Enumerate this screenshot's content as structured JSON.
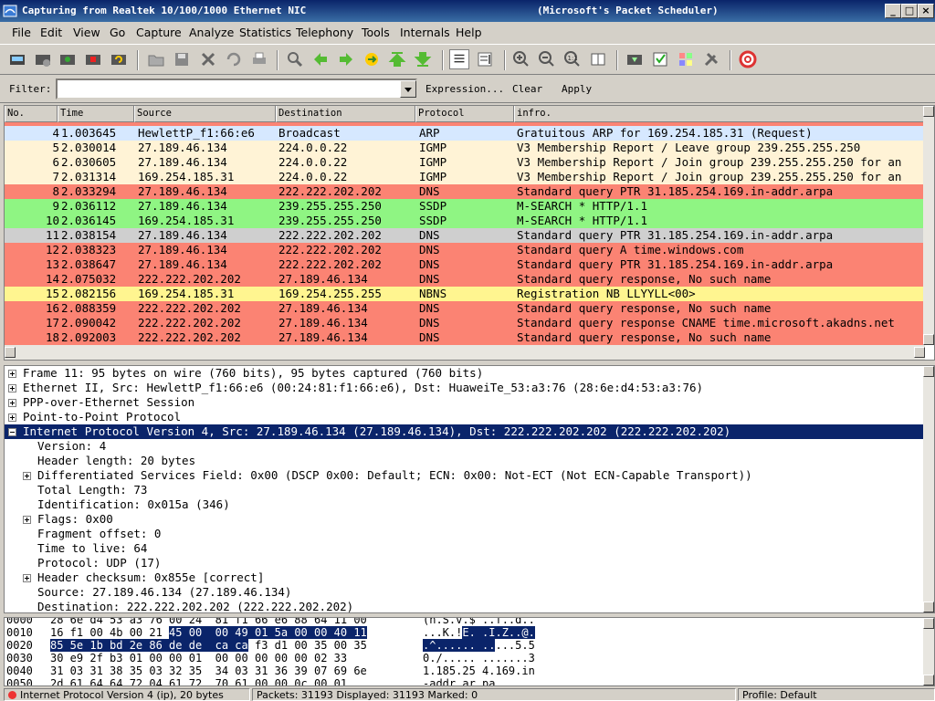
{
  "window": {
    "title": "Capturing from Realtek 10/100/1000 Ethernet NIC",
    "subtitle": "(Microsoft's Packet Scheduler)"
  },
  "menu": [
    "File",
    "Edit",
    "View",
    "Go",
    "Capture",
    "Analyze",
    "Statistics",
    "Telephony",
    "Tools",
    "Internals",
    "Help"
  ],
  "filter": {
    "label": "Filter:",
    "value": "",
    "expression": "Expression...",
    "clear": "Clear",
    "apply": "Apply"
  },
  "columns": [
    "No.",
    "Time",
    "Source",
    "Destination",
    "Protocol",
    "infro."
  ],
  "packets": [
    {
      "no": "4",
      "time": "1.003645",
      "src": "HewlettP_f1:66:e6",
      "dst": "Broadcast",
      "proto": "ARP",
      "info": "Gratuitous ARP for 169.254.185.31 (Request)",
      "color": "#d6e8ff"
    },
    {
      "no": "5",
      "time": "2.030014",
      "src": "27.189.46.134",
      "dst": "224.0.0.22",
      "proto": "IGMP",
      "info": "V3 Membership Report / Leave group 239.255.255.250",
      "color": "#fff3d6"
    },
    {
      "no": "6",
      "time": "2.030605",
      "src": "27.189.46.134",
      "dst": "224.0.0.22",
      "proto": "IGMP",
      "info": "V3 Membership Report / Join group 239.255.255.250 for an",
      "color": "#fff3d6"
    },
    {
      "no": "7",
      "time": "2.031314",
      "src": "169.254.185.31",
      "dst": "224.0.0.22",
      "proto": "IGMP",
      "info": "V3 Membership Report / Join group 239.255.255.250 for an",
      "color": "#fff3d6"
    },
    {
      "no": "8",
      "time": "2.033294",
      "src": "27.189.46.134",
      "dst": "222.222.202.202",
      "proto": "DNS",
      "info": "Standard query PTR 31.185.254.169.in-addr.arpa",
      "color": "#fb8373"
    },
    {
      "no": "9",
      "time": "2.036112",
      "src": "27.189.46.134",
      "dst": "239.255.255.250",
      "proto": "SSDP",
      "info": "M-SEARCH * HTTP/1.1",
      "color": "#8ff583"
    },
    {
      "no": "10",
      "time": "2.036145",
      "src": "169.254.185.31",
      "dst": "239.255.255.250",
      "proto": "SSDP",
      "info": "M-SEARCH * HTTP/1.1",
      "color": "#8ff583"
    },
    {
      "no": "11",
      "time": "2.038154",
      "src": "27.189.46.134",
      "dst": "222.222.202.202",
      "proto": "DNS",
      "info": "Standard query PTR 31.185.254.169.in-addr.arpa",
      "color": "#cfcfcf"
    },
    {
      "no": "12",
      "time": "2.038323",
      "src": "27.189.46.134",
      "dst": "222.222.202.202",
      "proto": "DNS",
      "info": "Standard query A time.windows.com",
      "color": "#fb8373"
    },
    {
      "no": "13",
      "time": "2.038647",
      "src": "27.189.46.134",
      "dst": "222.222.202.202",
      "proto": "DNS",
      "info": "Standard query PTR 31.185.254.169.in-addr.arpa",
      "color": "#fb8373"
    },
    {
      "no": "14",
      "time": "2.075032",
      "src": "222.222.202.202",
      "dst": "27.189.46.134",
      "proto": "DNS",
      "info": "Standard query response, No such name",
      "color": "#fb8373"
    },
    {
      "no": "15",
      "time": "2.082156",
      "src": "169.254.185.31",
      "dst": "169.254.255.255",
      "proto": "NBNS",
      "info": "Registration NB LLYYLL<00>",
      "color": "#fff590"
    },
    {
      "no": "16",
      "time": "2.088359",
      "src": "222.222.202.202",
      "dst": "27.189.46.134",
      "proto": "DNS",
      "info": "Standard query response, No such name",
      "color": "#fb8373"
    },
    {
      "no": "17",
      "time": "2.090042",
      "src": "222.222.202.202",
      "dst": "27.189.46.134",
      "proto": "DNS",
      "info": "Standard query response CNAME time.microsoft.akadns.net",
      "color": "#fb8373"
    },
    {
      "no": "18",
      "time": "2.092003",
      "src": "222.222.202.202",
      "dst": "27.189.46.134",
      "proto": "DNS",
      "info": "Standard query response, No such name",
      "color": "#fb8373"
    }
  ],
  "tree": [
    {
      "text": "Frame 11: 95 bytes on wire (760 bits), 95 bytes captured (760 bits)",
      "level": 0,
      "expander": "closed",
      "selected": false
    },
    {
      "text": "Ethernet II, Src: HewlettP_f1:66:e6 (00:24:81:f1:66:e6), Dst: HuaweiTe_53:a3:76 (28:6e:d4:53:a3:76)",
      "level": 0,
      "expander": "closed",
      "selected": false
    },
    {
      "text": "PPP-over-Ethernet Session",
      "level": 0,
      "expander": "closed",
      "selected": false
    },
    {
      "text": "Point-to-Point Protocol",
      "level": 0,
      "expander": "closed",
      "selected": false
    },
    {
      "text": "Internet Protocol Version 4, Src: 27.189.46.134 (27.189.46.134), Dst: 222.222.202.202 (222.222.202.202)",
      "level": 0,
      "expander": "open",
      "selected": true
    },
    {
      "text": "Version: 4",
      "level": 1,
      "expander": "none",
      "selected": false
    },
    {
      "text": "Header length: 20 bytes",
      "level": 1,
      "expander": "none",
      "selected": false
    },
    {
      "text": "Differentiated Services Field: 0x00 (DSCP 0x00: Default; ECN: 0x00: Not-ECT (Not ECN-Capable Transport))",
      "level": 1,
      "expander": "closed",
      "selected": false
    },
    {
      "text": "Total Length: 73",
      "level": 1,
      "expander": "none",
      "selected": false
    },
    {
      "text": "Identification: 0x015a (346)",
      "level": 1,
      "expander": "none",
      "selected": false
    },
    {
      "text": "Flags: 0x00",
      "level": 1,
      "expander": "closed",
      "selected": false
    },
    {
      "text": "Fragment offset: 0",
      "level": 1,
      "expander": "none",
      "selected": false
    },
    {
      "text": "Time to live: 64",
      "level": 1,
      "expander": "none",
      "selected": false
    },
    {
      "text": "Protocol: UDP (17)",
      "level": 1,
      "expander": "none",
      "selected": false
    },
    {
      "text": "Header checksum: 0x855e [correct]",
      "level": 1,
      "expander": "closed",
      "selected": false
    },
    {
      "text": "Source: 27.189.46.134 (27.189.46.134)",
      "level": 1,
      "expander": "none",
      "selected": false
    },
    {
      "text": "Destination: 222.222.202.202 (222.222.202.202)",
      "level": 1,
      "expander": "none",
      "selected": false
    }
  ],
  "bytes": [
    {
      "offset": "0000",
      "pre": "28 6e d4 53 a3 76 00 24  81 f1 66 e6 88 64 11 00",
      "hl": "",
      "post": "",
      "apre": "(n.S.v.$ ..f..d..",
      "ahl": "",
      "apost": ""
    },
    {
      "offset": "0010",
      "pre": "16 f1 00 4b 00 21 ",
      "hl": "45 00  00 49 01 5a 00 00 40 11",
      "post": "",
      "apre": "...K.!",
      "ahl": "E. .I.Z..@.",
      "apost": ""
    },
    {
      "offset": "0020",
      "pre": "",
      "hl": "85 5e 1b bd 2e 86 de de  ca ca",
      "post": " f3 d1 00 35 00 35",
      "apre": "",
      "ahl": ".^...... ..",
      "apost": "...5.5"
    },
    {
      "offset": "0030",
      "pre": "30 e9 2f b3 01 00 00 01  00 00 00 00 00 02 33",
      "hl": "",
      "post": "",
      "apre": "0./..... .......3",
      "ahl": "",
      "apost": ""
    },
    {
      "offset": "0040",
      "pre": "31 03 31 38 35 03 32 35  34 03 31 36 39 07 69 6e",
      "hl": "",
      "post": "",
      "apre": "1.185.25 4.169.in",
      "ahl": "",
      "apost": ""
    },
    {
      "offset": "0050",
      "pre": "2d 61 64 64 72 04 61 72  70 61 00 00 0c 00 01",
      "hl": "",
      "post": "",
      "apre": "-addr.ar pa.....",
      "ahl": "",
      "apost": ""
    }
  ],
  "status": {
    "field": "Internet Protocol Version 4 (ip), 20 bytes",
    "packets": "Packets: 31193 Displayed: 31193 Marked: 0",
    "profile": "Profile: Default"
  },
  "colors": {
    "selection": "#0a246a",
    "titlebar": "#0a246a",
    "dns": "#fb8373",
    "ssdp": "#8ff583",
    "igmp": "#fff3d6",
    "nbns": "#fff590",
    "arp": "#d6e8ff"
  }
}
